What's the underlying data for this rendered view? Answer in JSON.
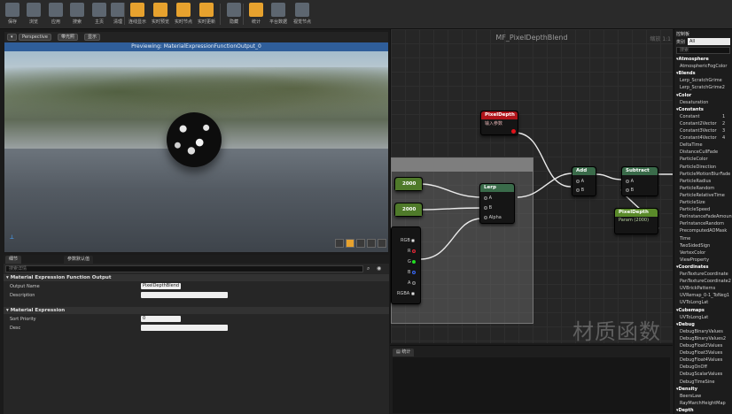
{
  "toolbar": {
    "buttons": [
      {
        "label": "保存",
        "icon": "save-icon"
      },
      {
        "label": "浏览",
        "icon": "search-icon"
      },
      {
        "label": "应用",
        "icon": "apply-icon"
      },
      {
        "label": "搜索",
        "icon": "binoculars-icon"
      },
      {
        "label": "主页",
        "icon": "home-icon"
      },
      {
        "label": "清理",
        "icon": "clean-icon"
      },
      {
        "label": "连线显示",
        "icon": "wire-icon",
        "active": true
      },
      {
        "label": "实时预览",
        "icon": "live-preview-icon",
        "active": true
      },
      {
        "label": "实时节点",
        "icon": "live-nodes-icon",
        "active": true
      },
      {
        "label": "实时更新",
        "icon": "live-update-icon",
        "active": true
      },
      {
        "label": "隐藏",
        "icon": "gear-icon"
      },
      {
        "label": "统计",
        "icon": "stats-icon",
        "active": true
      },
      {
        "label": "平台数据",
        "icon": "platform-icon"
      },
      {
        "label": "视觉节点",
        "icon": "nodes-icon"
      }
    ]
  },
  "viewport": {
    "mode_label": "Perspective",
    "lit_label": "带光照",
    "show_label": "显示",
    "preview_text": "Previewing: MaterialExpressionFunctionOutput_0"
  },
  "details": {
    "tabs": [
      "细节",
      "参数默认值"
    ],
    "search_placeholder": "搜索详情",
    "sections": [
      {
        "title": "Material Expression Function Output",
        "props": [
          {
            "label": "Output Name",
            "value": "PixelDepthBlend"
          },
          {
            "label": "Description",
            "value": ""
          }
        ]
      },
      {
        "title": "Material Expression",
        "props": [
          {
            "label": "Sort Priority",
            "value": "0"
          },
          {
            "label": "Desc",
            "value": ""
          }
        ]
      }
    ]
  },
  "graph": {
    "title": "MF_PixelDepthBlend",
    "zoom": "缩放 1:1",
    "watermark": "材质函数",
    "nodes": {
      "pixeldepth1": {
        "title": "PixelDepth",
        "subtitle": "输入参数",
        "color": "#b0141a"
      },
      "add": {
        "title": "Add",
        "pins": [
          "A",
          "B"
        ]
      },
      "subtract": {
        "title": "Subtract",
        "pins": [
          "A",
          "B"
        ]
      },
      "lerp": {
        "title": "Lerp",
        "pins": [
          "A",
          "B",
          "Alpha"
        ]
      },
      "const1": {
        "value": "2000"
      },
      "const2": {
        "value": "2000"
      },
      "pixeldepth2": {
        "title": "PixelDepth",
        "subtitle": "Param (2000)",
        "color": "#5a8a2a"
      },
      "mask": {
        "pins": [
          "RGB",
          "R",
          "G",
          "B",
          "A",
          "RGBA"
        ]
      }
    }
  },
  "stats": {
    "tab_label": "统计"
  },
  "palette": {
    "title": "控制板",
    "category_label": "类别",
    "category_value": "All",
    "search_placeholder": "搜索",
    "entries": [
      {
        "type": "cat",
        "text": "Atmosphere"
      },
      {
        "type": "item",
        "text": "AtmosphericFogColor"
      },
      {
        "type": "cat",
        "text": "Blends"
      },
      {
        "type": "item",
        "text": "Lerp_ScratchGrime"
      },
      {
        "type": "item",
        "text": "Lerp_ScratchGrime2"
      },
      {
        "type": "cat",
        "text": "Color"
      },
      {
        "type": "item",
        "text": "Desaturation"
      },
      {
        "type": "cat",
        "text": "Constants"
      },
      {
        "type": "item",
        "text": "Constant",
        "val": "1"
      },
      {
        "type": "item",
        "text": "Constant2Vector",
        "val": "2"
      },
      {
        "type": "item",
        "text": "Constant3Vector",
        "val": "3"
      },
      {
        "type": "item",
        "text": "Constant4Vector",
        "val": "4"
      },
      {
        "type": "item",
        "text": "DeltaTime"
      },
      {
        "type": "item",
        "text": "DistanceCullFade"
      },
      {
        "type": "item",
        "text": "ParticleColor"
      },
      {
        "type": "item",
        "text": "ParticleDirection"
      },
      {
        "type": "item",
        "text": "ParticleMotionBlurFade"
      },
      {
        "type": "item",
        "text": "ParticleRadius"
      },
      {
        "type": "item",
        "text": "ParticleRandom"
      },
      {
        "type": "item",
        "text": "ParticleRelativeTime"
      },
      {
        "type": "item",
        "text": "ParticleSize"
      },
      {
        "type": "item",
        "text": "ParticleSpeed"
      },
      {
        "type": "item",
        "text": "PerInstanceFadeAmount"
      },
      {
        "type": "item",
        "text": "PerInstanceRandom"
      },
      {
        "type": "item",
        "text": "PrecomputedAOMask"
      },
      {
        "type": "item",
        "text": "Time"
      },
      {
        "type": "item",
        "text": "TwoSidedSign"
      },
      {
        "type": "item",
        "text": "VertexColor"
      },
      {
        "type": "item",
        "text": "ViewProperty"
      },
      {
        "type": "cat",
        "text": "Coordinates"
      },
      {
        "type": "item",
        "text": "PanTextureCoordinate"
      },
      {
        "type": "item",
        "text": "PanTextureCoordinate2"
      },
      {
        "type": "item",
        "text": "UVBrickPatterns"
      },
      {
        "type": "item",
        "text": "UVRemap_0-1_ToNeg1"
      },
      {
        "type": "item",
        "text": "UVToLongLat"
      },
      {
        "type": "cat",
        "text": "Cubemaps"
      },
      {
        "type": "item",
        "text": "UVToLongLat"
      },
      {
        "type": "cat",
        "text": "Debug"
      },
      {
        "type": "item",
        "text": "DebugBinaryValues"
      },
      {
        "type": "item",
        "text": "DebugBinaryValues2"
      },
      {
        "type": "item",
        "text": "DebugFloat2Values"
      },
      {
        "type": "item",
        "text": "DebugFloat3Values"
      },
      {
        "type": "item",
        "text": "DebugFloat4Values"
      },
      {
        "type": "item",
        "text": "DebugOnOff"
      },
      {
        "type": "item",
        "text": "DebugScalarValues"
      },
      {
        "type": "item",
        "text": "DebugTimeSine"
      },
      {
        "type": "cat",
        "text": "Density"
      },
      {
        "type": "item",
        "text": "BeersLaw"
      },
      {
        "type": "item",
        "text": "RayMarchHeightMap"
      },
      {
        "type": "cat",
        "text": "Depth"
      }
    ]
  }
}
